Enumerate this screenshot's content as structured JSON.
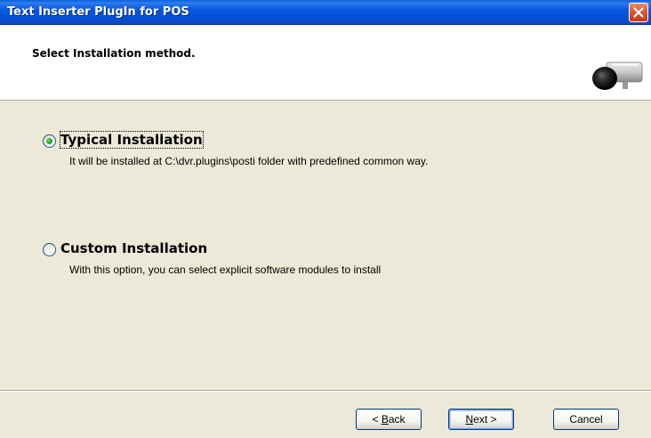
{
  "window": {
    "title": "Text Inserter PlugIn for POS"
  },
  "header": {
    "heading": "Select Installation method.",
    "image": "camera-icon"
  },
  "options": [
    {
      "label": "Typical Installation",
      "description": "It will be installed at C:\\dvr.plugins\\posti folder with predefined common way.",
      "checked": true
    },
    {
      "label": "Custom Installation",
      "description": "With this option, you can select explicit software modules to install",
      "checked": false
    }
  ],
  "buttons": {
    "back_prefix": "< ",
    "back_hotkey": "B",
    "back_rest": "ack",
    "next_hotkey": "N",
    "next_rest": "ext >",
    "cancel": "Cancel"
  },
  "colors": {
    "titlebar": "#0658e0",
    "close": "#e2552e",
    "dialog_bg": "#ece9d8",
    "radio_dot": "#21a121"
  }
}
